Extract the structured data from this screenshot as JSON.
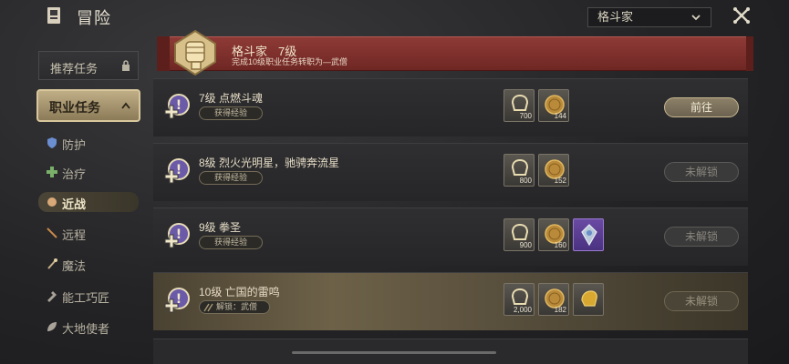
{
  "header": {
    "title": "冒险",
    "class_select": "格斗家"
  },
  "sidebar": {
    "recommended": "推荐任务",
    "job_quests": "职业任务",
    "items": [
      {
        "label": "防护",
        "icon": "shield-icon"
      },
      {
        "label": "治疗",
        "icon": "heal-cross-icon"
      },
      {
        "label": "近战",
        "icon": "fist-icon"
      },
      {
        "label": "远程",
        "icon": "arrow-icon"
      },
      {
        "label": "魔法",
        "icon": "magic-icon"
      },
      {
        "label": "能工巧匠",
        "icon": "craft-icon"
      },
      {
        "label": "大地使者",
        "icon": "leaf-icon"
      }
    ]
  },
  "banner": {
    "class_name": "格斗家",
    "level": "7级",
    "subtitle": "完成10级职业任务转职为—武僧"
  },
  "quests": [
    {
      "name": "7级 点燃斗魂",
      "tag": "获得经验",
      "rewards": [
        "700",
        "144"
      ],
      "button": "前往"
    },
    {
      "name": "8级 烈火光明星，驰骋奔流星",
      "tag": "获得经验",
      "rewards": [
        "800",
        "152"
      ],
      "button": "未解锁"
    },
    {
      "name": "9级 拳圣",
      "tag": "获得经验",
      "rewards": [
        "900",
        "160"
      ],
      "button": "未解锁"
    },
    {
      "name": "10级 亡国的雷鸣",
      "tag": "解锁：武僧",
      "rewards": [
        "2,000",
        "182"
      ],
      "button": "未解锁"
    }
  ],
  "colors": {
    "accent_gold": "#c6b690",
    "banner_red": "#8e3a36",
    "purple_reward": "#6a4aa4"
  }
}
